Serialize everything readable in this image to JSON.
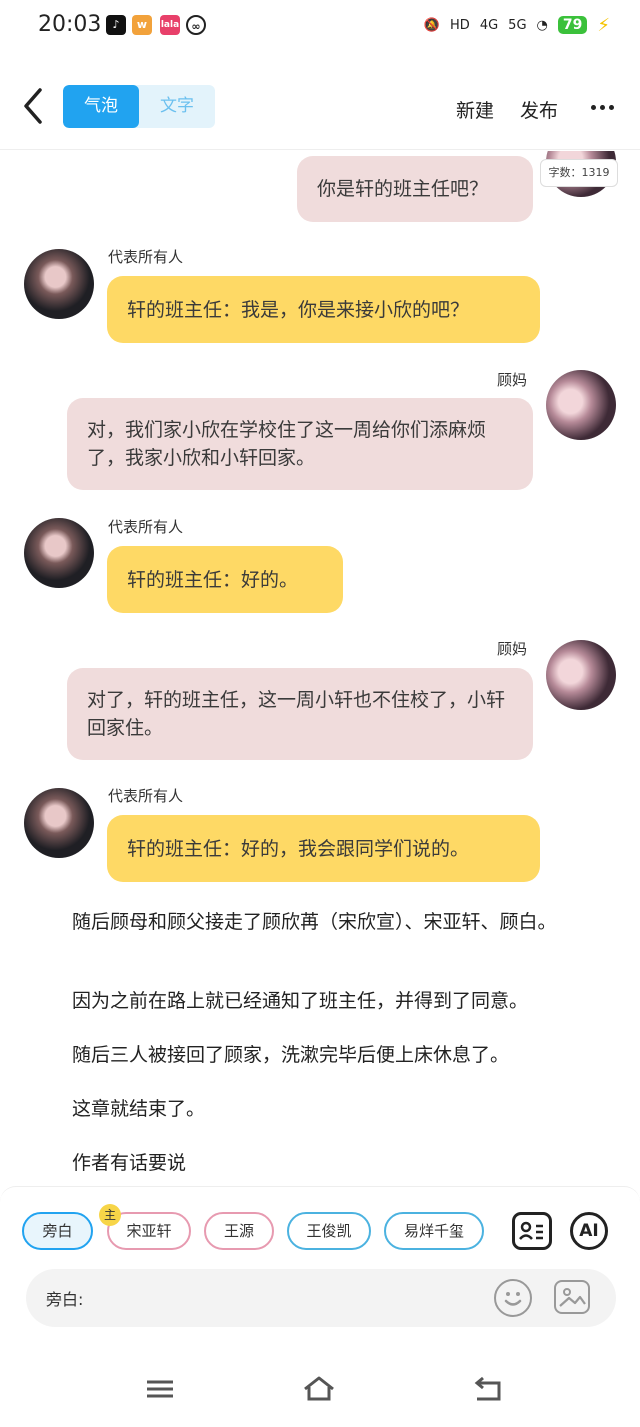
{
  "status": {
    "time": "20:03",
    "apps": [
      "tiktok-icon",
      "weibo-icon",
      "lala-icon",
      "link-icon"
    ],
    "signal_1": "HD",
    "net_1": "4G",
    "net_2": "5G",
    "battery": "79"
  },
  "header": {
    "mode_bubble": "气泡",
    "mode_text": "文字",
    "new_label": "新建",
    "publish_label": "发布"
  },
  "word_count": "字数：1319",
  "messages": [
    {
      "side": "right",
      "name": "",
      "text": "你是轩的班主任吧？",
      "style": "pink"
    },
    {
      "side": "left",
      "name": "代表所有人",
      "text": "轩的班主任：我是，你是来接小欣的吧？",
      "style": "yellow"
    },
    {
      "side": "right",
      "name": "顾妈",
      "text": "对，我们家小欣在学校住了这一周给你们添麻烦了，我家小欣和小轩回家。",
      "style": "pink"
    },
    {
      "side": "left",
      "name": "代表所有人",
      "text": "轩的班主任：好的。",
      "style": "yellow"
    },
    {
      "side": "right",
      "name": "顾妈",
      "text": "对了，轩的班主任，这一周小轩也不住校了，小轩回家住。",
      "style": "pink"
    },
    {
      "side": "left",
      "name": "代表所有人",
      "text": "轩的班主任：好的，我会跟同学们说的。",
      "style": "yellow"
    }
  ],
  "narration": [
    "随后顾母和顾父接走了顾欣苒（宋欣宣）、宋亚轩、顾白。",
    "因为之前在路上就已经通知了班主任，并得到了同意。",
    "随后三人被接回了顾家，洗漱完毕后便上床休息了。",
    "这章就结束了。",
    "作者有话要说"
  ],
  "roles": [
    "旁白",
    "宋亚轩",
    "王源",
    "王俊凯",
    "易烊千玺"
  ],
  "host_badge": "主",
  "ai_label": "AI",
  "input_label": "旁白:",
  "colors": {
    "accent_blue": "#21a3f0",
    "bubble_pink": "#f0dcdc",
    "bubble_yellow": "#fed965"
  }
}
